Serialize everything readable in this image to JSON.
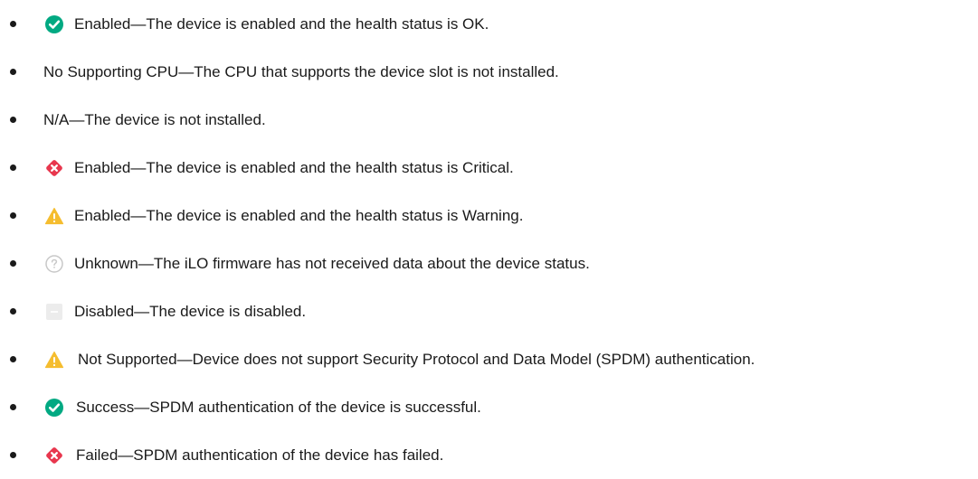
{
  "items": [
    {
      "icon": "ok-check-icon",
      "text": "Enabled—The device is enabled and the health status is  OK."
    },
    {
      "icon": "",
      "text": "No Supporting CPU—The CPU that supports the device slot is not installed."
    },
    {
      "icon": "",
      "text": "N/A—The device is not installed."
    },
    {
      "icon": "critical-x-icon",
      "text": "Enabled—The device is enabled and the health status is  Critical."
    },
    {
      "icon": "warning-triangle-icon",
      "text": "Enabled—The device is enabled and the health status is  Warning."
    },
    {
      "icon": "unknown-question-icon",
      "text": "Unknown—The iLO firmware has not received data about the device status."
    },
    {
      "icon": "disabled-dash-icon",
      "text": "Disabled—The device is disabled."
    },
    {
      "icon": "warning-triangle-icon",
      "text": "Not Supported—Device does not support Security Protocol and Data Model (SPDM) authentication."
    },
    {
      "icon": "ok-check-icon",
      "text": "Success—SPDM authentication of the device is successful."
    },
    {
      "icon": "critical-x-icon",
      "text": "Failed—SPDM authentication of the device has failed."
    }
  ],
  "colors": {
    "ok": "#01a982",
    "critical": "#e8374e",
    "warning": "#f5bd2f",
    "unknown": "#bdbdbd",
    "disabled": "#e6e6e6"
  }
}
